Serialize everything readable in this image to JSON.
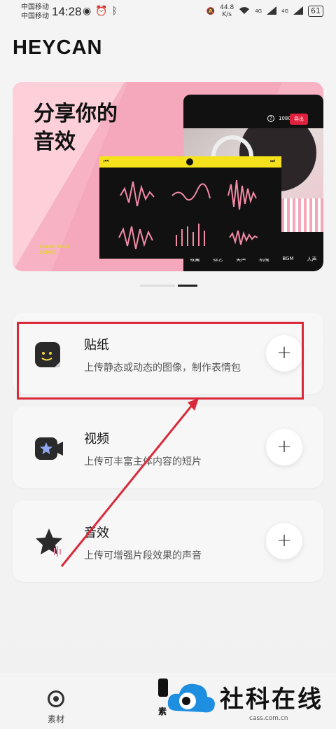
{
  "status": {
    "carrier1": "中国移动",
    "carrier2": "中国移动",
    "time": "14:28",
    "speed": "44.8\nK/s",
    "speed_top": "44.8",
    "speed_bottom": "K/s",
    "net1": "4G",
    "net2": "4G",
    "battery": "61"
  },
  "brand": "HEYCAN",
  "banner": {
    "title_line1": "分享你的",
    "title_line2": "音效",
    "small_line1": "SHARE YOUR",
    "small_line2": "SOUND",
    "resolution": "1080P ▾",
    "export": "导出",
    "tabs": [
      "收藏",
      "综艺",
      "笑声",
      "机械",
      "BGM",
      "人声"
    ]
  },
  "cards": [
    {
      "title": "贴纸",
      "desc": "上传静态或动态的图像，制作表情包",
      "icon": "sticker-icon"
    },
    {
      "title": "视频",
      "desc": "上传可丰富主体内容的短片",
      "icon": "video-camera-icon"
    },
    {
      "title": "音效",
      "desc": "上传可增强片段效果的声音",
      "icon": "star-sound-icon"
    }
  ],
  "plus_label": "+",
  "tabbar": {
    "tab1": "素材",
    "tab2": "素"
  },
  "watermark": {
    "text": "社科在线",
    "url": "cass.com.cn"
  },
  "colors": {
    "highlight": "#d82a3a",
    "banner_pink": "#f7b3c4",
    "wave_yellow": "#f5e21c",
    "export_red": "#e0203c"
  }
}
